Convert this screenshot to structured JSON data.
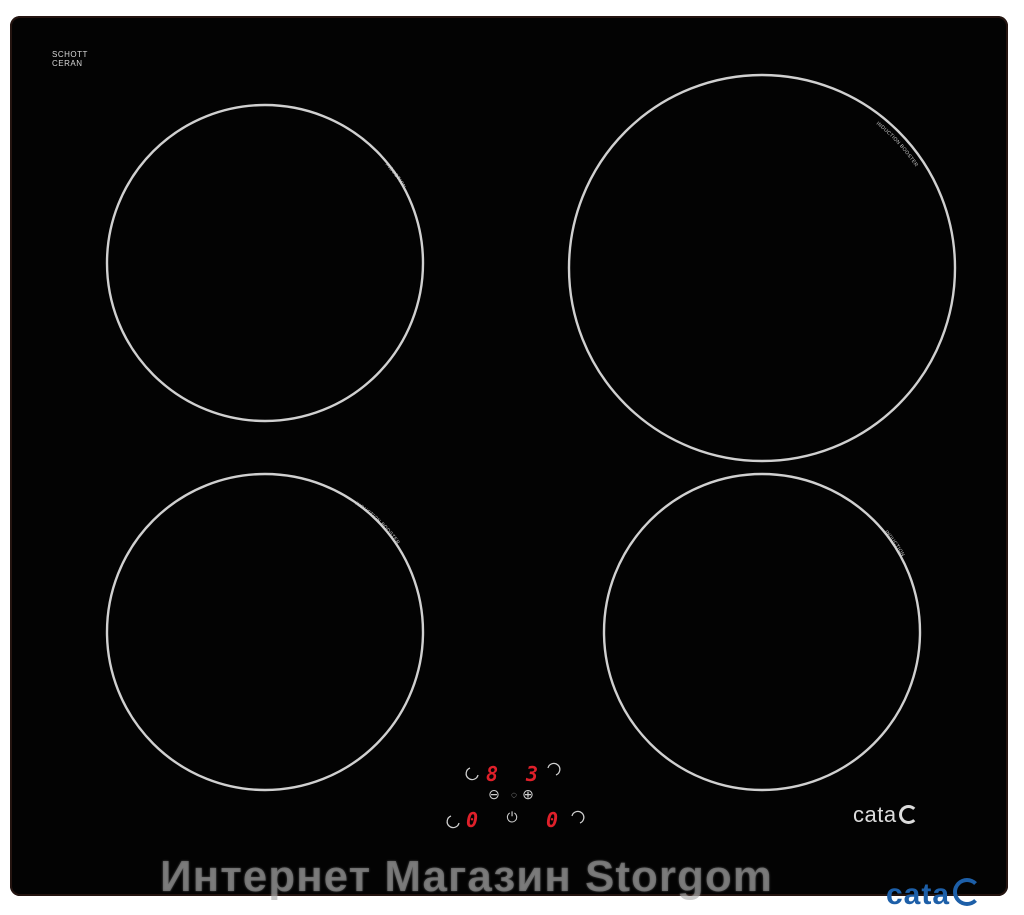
{
  "seal": {
    "line1": "SCHOTT",
    "line2": "CERAN"
  },
  "zones": [
    {
      "label": "INDUCTION"
    },
    {
      "label": "INDUCTION BOOSTER"
    },
    {
      "label": "INDUCTION BOOSTER"
    },
    {
      "label": "INDUCTION"
    }
  ],
  "controls": {
    "display_top_left": "8",
    "display_top_right": "3",
    "display_bottom_left": "0",
    "display_bottom_right": "0",
    "minus_symbol": "⊖",
    "plus_symbol": "⊕",
    "power_symbol": "⏻",
    "timer_symbol": "◌"
  },
  "brand": {
    "text": "cata"
  },
  "watermark": {
    "text": "Интернет Магазин Storgom"
  },
  "corner_logo": {
    "text": "cata"
  },
  "colors": {
    "glass": "#030303",
    "ring": "#d0d0d0",
    "display": "#e0202a",
    "logo": "#1d5fa8"
  }
}
